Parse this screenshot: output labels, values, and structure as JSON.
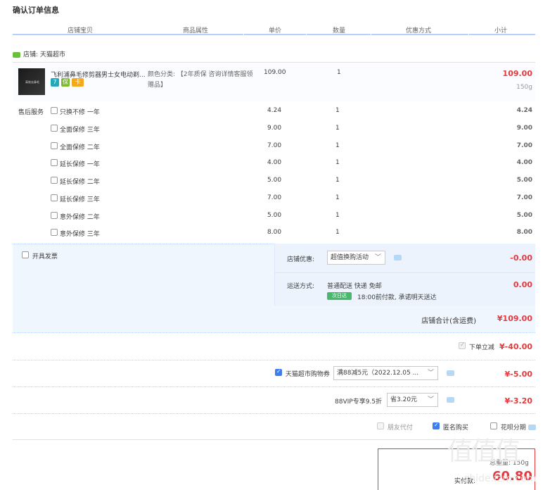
{
  "title": "确认订单信息",
  "headers": {
    "shop_item": "店铺宝贝",
    "attrs": "商品属性",
    "price": "单价",
    "qty": "数量",
    "discount": "优惠方式",
    "subtotal": "小计"
  },
  "shop": {
    "label": "店铺: 天猫超市"
  },
  "item": {
    "name": "飞利浦鼻毛修剪器男士女电动剃...",
    "thumb_text": "高效去鼻毛",
    "attrs": "颜色分类: 【2年质保 咨询详情客服领赠品】",
    "price": "109.00",
    "qty": "1",
    "subtotal": "109.00",
    "weight": "150g",
    "badges": [
      "7",
      "保",
      "卡"
    ]
  },
  "service": {
    "label": "售后服务",
    "options": [
      {
        "label": "只换不修 一年",
        "price": "4.24",
        "qty": "1",
        "subtotal": "4.24"
      },
      {
        "label": "全面保修 三年",
        "price": "9.00",
        "qty": "1",
        "subtotal": "9.00"
      },
      {
        "label": "全面保修 二年",
        "price": "7.00",
        "qty": "1",
        "subtotal": "7.00"
      },
      {
        "label": "延长保修 一年",
        "price": "4.00",
        "qty": "1",
        "subtotal": "4.00"
      },
      {
        "label": "延长保修 二年",
        "price": "5.00",
        "qty": "1",
        "subtotal": "5.00"
      },
      {
        "label": "延长保修 三年",
        "price": "7.00",
        "qty": "1",
        "subtotal": "7.00"
      },
      {
        "label": "意外保修 二年",
        "price": "5.00",
        "qty": "1",
        "subtotal": "5.00"
      },
      {
        "label": "意外保修 三年",
        "price": "8.00",
        "qty": "1",
        "subtotal": "8.00"
      }
    ]
  },
  "invoice": {
    "label": "开具发票"
  },
  "shop_discount": {
    "label": "店铺优惠:",
    "value": "超值换购活动",
    "amount": "-0.00"
  },
  "shipping": {
    "label": "运送方式:",
    "method": "普通配送 快递 免邮",
    "tag": "次日达",
    "note": "18:00前付款, 承诺明天送达",
    "amount": "0.00"
  },
  "shop_total": {
    "label": "店铺合计(含运费)",
    "amount": "¥109.00"
  },
  "order_discount": {
    "label": "下单立减",
    "amount": "¥-40.00"
  },
  "coupon": {
    "label": "天猫超市购物券",
    "value": "满88减5元（2022.12.05 ...",
    "amount": "¥-5.00"
  },
  "vip": {
    "label": "88VIP专享9.5折",
    "value": "省3.20元",
    "amount": "¥-3.20"
  },
  "options": {
    "friend_pay": "朋友代付",
    "anonymous": "匿名购买",
    "huabei": "花呗分期"
  },
  "summary": {
    "weight": "总重量: 150g",
    "pay_label": "实付款:",
    "pay_amount": "60.80"
  },
  "watermark": "值值值",
  "watermark_url": "zhide.fzm.com",
  "colors": {
    "accent": "#e4393c",
    "blue": "#3a7ef1",
    "line": "#b2d1ff"
  }
}
